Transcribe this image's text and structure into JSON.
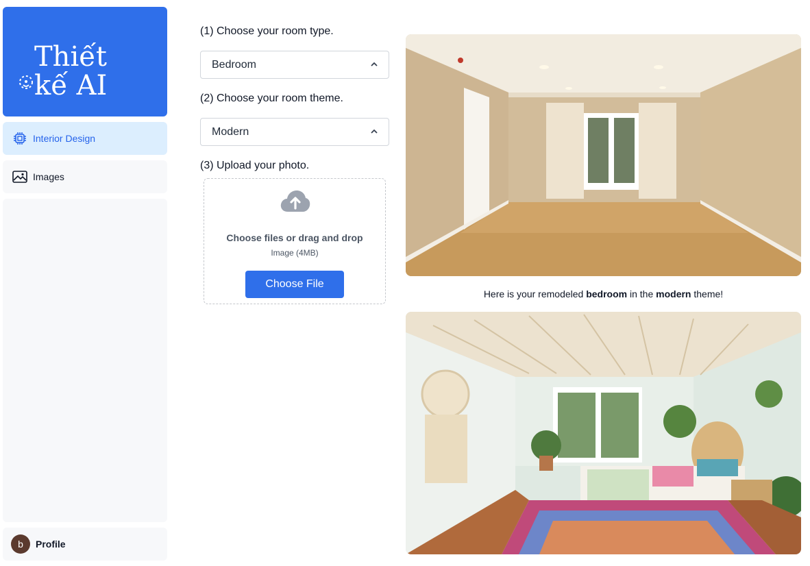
{
  "app": {
    "logo_line1": "Thiết",
    "logo_line2": "kế AI"
  },
  "sidebar": {
    "items": [
      {
        "label": "Interior Design",
        "icon": "cpu-chip-icon",
        "active": true
      },
      {
        "label": "Images",
        "icon": "image-icon",
        "active": false
      }
    ],
    "profile": {
      "avatar_letter": "b",
      "label": "Profile"
    }
  },
  "form": {
    "step1_label": "(1) Choose your room type.",
    "room_type": "Bedroom",
    "step2_label": "(2) Choose your room theme.",
    "room_theme": "Modern",
    "step3_label": "(3) Upload your photo.",
    "upload": {
      "title": "Choose files or drag and drop",
      "subtitle": "Image (4MB)",
      "button_label": "Choose File"
    }
  },
  "result": {
    "caption_prefix": "Here is your remodeled ",
    "caption_room": "bedroom",
    "caption_mid": " in the ",
    "caption_theme": "modern",
    "caption_suffix": " theme!"
  },
  "colors": {
    "brand": "#2f6fea",
    "active_bg": "#dceefe",
    "active_text": "#2563eb"
  }
}
